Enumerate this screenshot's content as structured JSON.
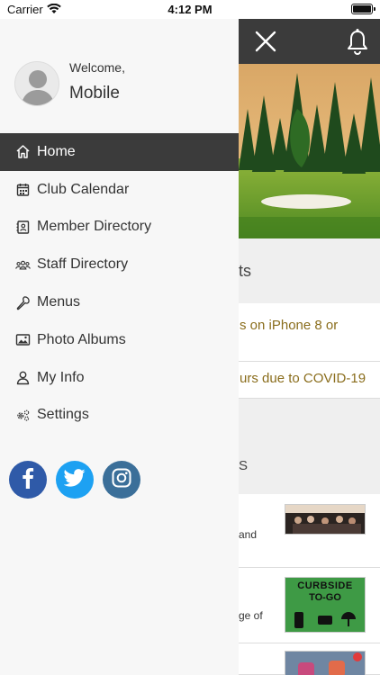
{
  "status_bar": {
    "carrier": "Carrier",
    "time": "4:12 PM"
  },
  "drawer": {
    "welcome": "Welcome,",
    "username": "Mobile",
    "menu": [
      {
        "label": "Home",
        "icon": "home-icon",
        "active": true
      },
      {
        "label": "Club Calendar",
        "icon": "calendar-icon"
      },
      {
        "label": "Member Directory",
        "icon": "contact-book-icon"
      },
      {
        "label": "Staff Directory",
        "icon": "group-icon"
      },
      {
        "label": "Menus",
        "icon": "utensil-icon"
      },
      {
        "label": "Photo Albums",
        "icon": "image-icon"
      },
      {
        "label": "My Info",
        "icon": "person-icon"
      },
      {
        "label": "Settings",
        "icon": "gears-icon"
      }
    ],
    "social": [
      {
        "name": "facebook",
        "icon": "facebook-icon",
        "color": "#2f5aa8"
      },
      {
        "name": "twitter",
        "icon": "twitter-icon",
        "color": "#1da1f2"
      },
      {
        "name": "instagram",
        "icon": "instagram-icon",
        "color": "#3b6f99"
      }
    ]
  },
  "background": {
    "header_color": "#3b3b3b",
    "section1_title": "ts",
    "news": [
      {
        "text_line1": "s on iPhone 8 or",
        "text_line2": ""
      },
      {
        "text_line1": "urs due to COVID-19"
      }
    ],
    "section2_title": "S",
    "features": [
      {
        "text": "and"
      },
      {
        "text": "ge of",
        "thumb_title": "CURBSIDE",
        "thumb_sub": "TO-GO"
      },
      {
        "text": ""
      }
    ]
  }
}
